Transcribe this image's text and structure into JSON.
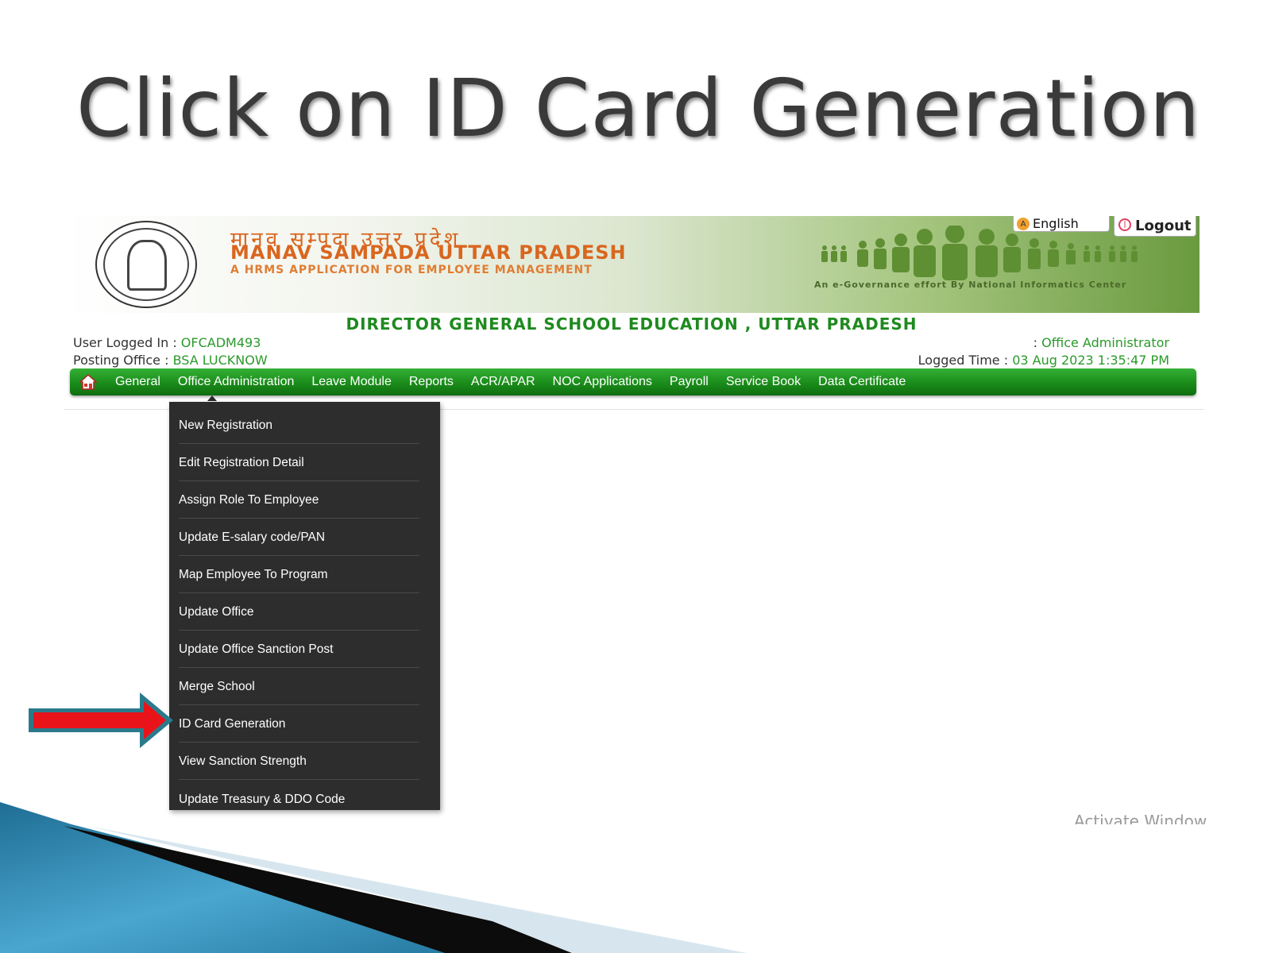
{
  "slide_title": "Click on ID Card Generation",
  "header": {
    "hindi_title": "मानव सम्पदा उत्तर प्रदेश",
    "title": "MANAV SAMPADA UTTAR PRADESH",
    "tagline": "A HRMS APPLICATION FOR EMPLOYEE MANAGEMENT",
    "egov_note": "An e-Governance effort By National Informatics Center",
    "language_label": "English",
    "logout_label": "Logout"
  },
  "department": "DIRECTOR GENERAL SCHOOL EDUCATION , UTTAR PRADESH",
  "user_info": {
    "logged_in_label": "User Logged In : ",
    "logged_in_value": "OFCADM493",
    "posting_label": "Posting Office : ",
    "posting_value": "BSA LUCKNOW",
    "role_label": ": ",
    "role_value": "Office Administrator",
    "time_label": "Logged Time : ",
    "time_value": "03 Aug 2023 1:35:47 PM"
  },
  "nav": {
    "items": [
      "General",
      "Office Administration",
      "Leave Module",
      "Reports",
      "ACR/APAR",
      "NOC Applications",
      "Payroll",
      "Service Book",
      "Data Certificate"
    ],
    "active_item": "Office Administration"
  },
  "dropdown": {
    "items": [
      "New Registration",
      "Edit Registration Detail",
      "Assign Role To Employee",
      "Update E-salary code/PAN",
      "Map Employee To Program",
      "Update Office",
      "Update Office Sanction Post",
      "Merge School",
      "ID Card Generation",
      "View Sanction Strength",
      "Update Treasury & DDO Code"
    ],
    "highlighted_item": "ID Card Generation"
  },
  "watermark": "Activate Window",
  "colors": {
    "nav_green": "#1a8c1a",
    "accent_orange": "#d9661f",
    "value_green": "#2a9a2a",
    "menu_dark": "#2d2d2d",
    "arrow_red": "#e8141a"
  }
}
